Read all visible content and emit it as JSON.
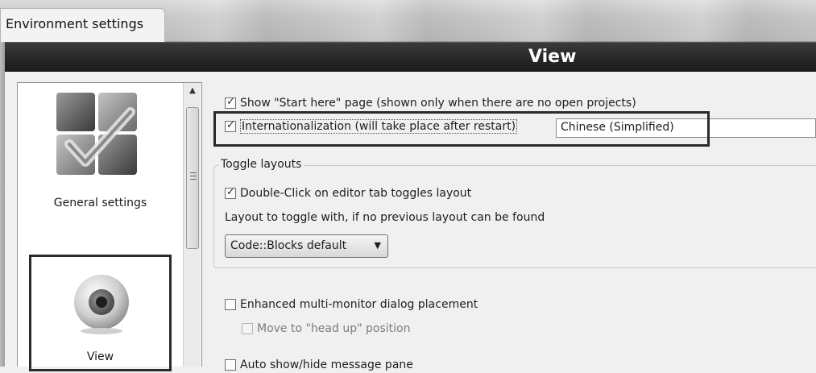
{
  "window": {
    "title": "Environment settings"
  },
  "header": {
    "title": "View"
  },
  "sidebar": {
    "items": [
      {
        "label": "General settings",
        "icon": "general-settings-icon"
      },
      {
        "label": "View",
        "icon": "view-eye-icon"
      }
    ]
  },
  "view": {
    "show_start_here": {
      "label": "Show \"Start here\" page (shown only when there are no open projects)",
      "checked": true
    },
    "internationalization": {
      "label": "Internationalization (will take place after restart)",
      "checked": true,
      "language": "Chinese (Simplified)"
    },
    "toggle_layouts": {
      "legend": "Toggle layouts",
      "double_click": {
        "label": "Double-Click on editor tab toggles layout",
        "checked": true
      },
      "layout_label": "Layout to toggle with, if no previous layout can be found",
      "layout_value": "Code::Blocks default"
    },
    "enhanced_multi_monitor": {
      "label": "Enhanced multi-monitor dialog placement",
      "checked": false
    },
    "head_up": {
      "label": "Move to \"head up\" position",
      "checked": false,
      "enabled": false
    },
    "auto_show_hide": {
      "label": "Auto show/hide message pane",
      "checked": false
    }
  },
  "colors": {
    "header_bg": "#262626",
    "header_text": "#ffffff",
    "highlight_border": "#2a2a2a"
  }
}
